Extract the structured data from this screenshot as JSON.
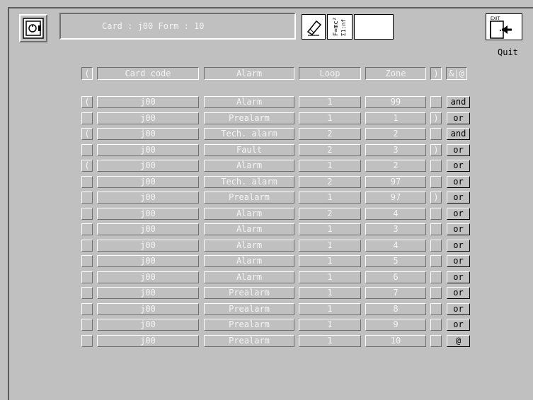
{
  "header": {
    "card_form": "Card : j00   Form : 10",
    "formula_icon_text": "F=mc²",
    "quit_label": "Quit",
    "exit_icon_text": "EXIT"
  },
  "columns": {
    "open_paren": "(",
    "card_code": "Card code",
    "alarm": "Alarm",
    "loop": "Loop",
    "zone": "Zone",
    "close_paren": ")",
    "operator": "&|@"
  },
  "rows": [
    {
      "open": "(",
      "card": "j00",
      "alarm": "Alarm",
      "loop": "1",
      "zone": "99",
      "close": "",
      "op": "and"
    },
    {
      "open": "",
      "card": "j00",
      "alarm": "Prealarm",
      "loop": "1",
      "zone": "1",
      "close": ")",
      "op": "or"
    },
    {
      "open": "(",
      "card": "j00",
      "alarm": "Tech. alarm",
      "loop": "2",
      "zone": "2",
      "close": "",
      "op": "and"
    },
    {
      "open": "",
      "card": "j00",
      "alarm": "Fault",
      "loop": "2",
      "zone": "3",
      "close": ")",
      "op": "or"
    },
    {
      "open": "(",
      "card": "j00",
      "alarm": "Alarm",
      "loop": "1",
      "zone": "2",
      "close": "",
      "op": "or"
    },
    {
      "open": "",
      "card": "j00",
      "alarm": "Tech. alarm",
      "loop": "2",
      "zone": "97",
      "close": "",
      "op": "or"
    },
    {
      "open": "",
      "card": "j00",
      "alarm": "Prealarm",
      "loop": "1",
      "zone": "97",
      "close": ")",
      "op": "or"
    },
    {
      "open": "",
      "card": "j00",
      "alarm": "Alarm",
      "loop": "2",
      "zone": "4",
      "close": "",
      "op": "or"
    },
    {
      "open": "",
      "card": "j00",
      "alarm": "Alarm",
      "loop": "1",
      "zone": "3",
      "close": "",
      "op": "or"
    },
    {
      "open": "",
      "card": "j00",
      "alarm": "Alarm",
      "loop": "1",
      "zone": "4",
      "close": "",
      "op": "or"
    },
    {
      "open": "",
      "card": "j00",
      "alarm": "Alarm",
      "loop": "1",
      "zone": "5",
      "close": "",
      "op": "or"
    },
    {
      "open": "",
      "card": "j00",
      "alarm": "Alarm",
      "loop": "1",
      "zone": "6",
      "close": "",
      "op": "or"
    },
    {
      "open": "",
      "card": "j00",
      "alarm": "Prealarm",
      "loop": "1",
      "zone": "7",
      "close": "",
      "op": "or"
    },
    {
      "open": "",
      "card": "j00",
      "alarm": "Prealarm",
      "loop": "1",
      "zone": "8",
      "close": "",
      "op": "or"
    },
    {
      "open": "",
      "card": "j00",
      "alarm": "Prealarm",
      "loop": "1",
      "zone": "9",
      "close": "",
      "op": "or"
    },
    {
      "open": "",
      "card": "j00",
      "alarm": "Prealarm",
      "loop": "1",
      "zone": "10",
      "close": "",
      "op": "@"
    }
  ]
}
